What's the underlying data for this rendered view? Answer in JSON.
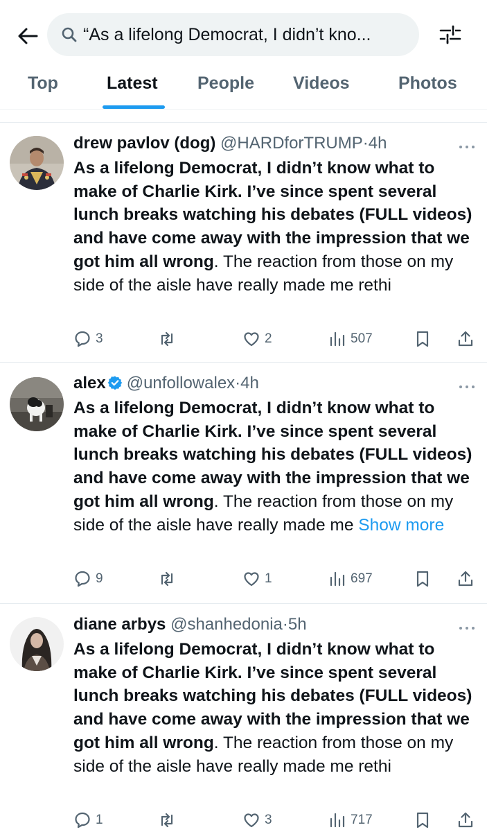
{
  "search": {
    "query": "“As a lifelong Democrat, I didn’t kno..."
  },
  "tabs": [
    {
      "label": "Top",
      "active": false
    },
    {
      "label": "Latest",
      "active": true
    },
    {
      "label": "People",
      "active": false
    },
    {
      "label": "Videos",
      "active": false
    },
    {
      "label": "Photos",
      "active": false
    }
  ],
  "colors": {
    "accent": "#1d9bf0",
    "text": "#0f1419",
    "muted": "#536471"
  },
  "tweets": [
    {
      "name": "drew pavlov (dog)",
      "handle": "@HARDforTRUMP",
      "dot": "·",
      "time": "4h",
      "verified": false,
      "bold_text": "As a lifelong Democrat, I didn’t know what to make of Charlie Kirk. I’ve since spent several lunch breaks watching his debates (FULL videos) and have come away with the impression that we got him all wrong",
      "plain_text": ". The reaction from those on my side of the aisle have really made me rethi",
      "show_more": "",
      "replies": "3",
      "reposts": "",
      "likes": "2",
      "views": "507"
    },
    {
      "name": "alex",
      "handle": "@unfollowalex",
      "dot": "·",
      "time": "4h",
      "verified": true,
      "bold_text": "As a lifelong Democrat, I didn’t know what to make of Charlie Kirk. I’ve since spent several lunch breaks watching his debates (FULL videos) and have come away with the impression that we got him all wrong",
      "plain_text": ". The reaction from those on my side of the aisle have really made me ",
      "show_more": "Show more",
      "replies": "9",
      "reposts": "",
      "likes": "1",
      "views": "697"
    },
    {
      "name": "diane arbys",
      "handle": "@shanhedonia",
      "dot": "·",
      "time": "5h",
      "verified": false,
      "bold_text": "As a lifelong Democrat, I didn’t know what to make of Charlie Kirk. I’ve since spent several lunch breaks watching his debates (FULL videos) and have come away with the impression that we got him all wrong",
      "plain_text": ". The reaction from those on my side of the aisle have really made me rethi",
      "show_more": "",
      "replies": "1",
      "reposts": "",
      "likes": "3",
      "views": "717"
    }
  ],
  "icons": [
    "back-arrow-icon",
    "search-icon",
    "filter-icon",
    "more-icon",
    "reply-icon",
    "repost-icon",
    "like-icon",
    "views-icon",
    "bookmark-icon",
    "share-icon",
    "verified-badge-icon"
  ]
}
